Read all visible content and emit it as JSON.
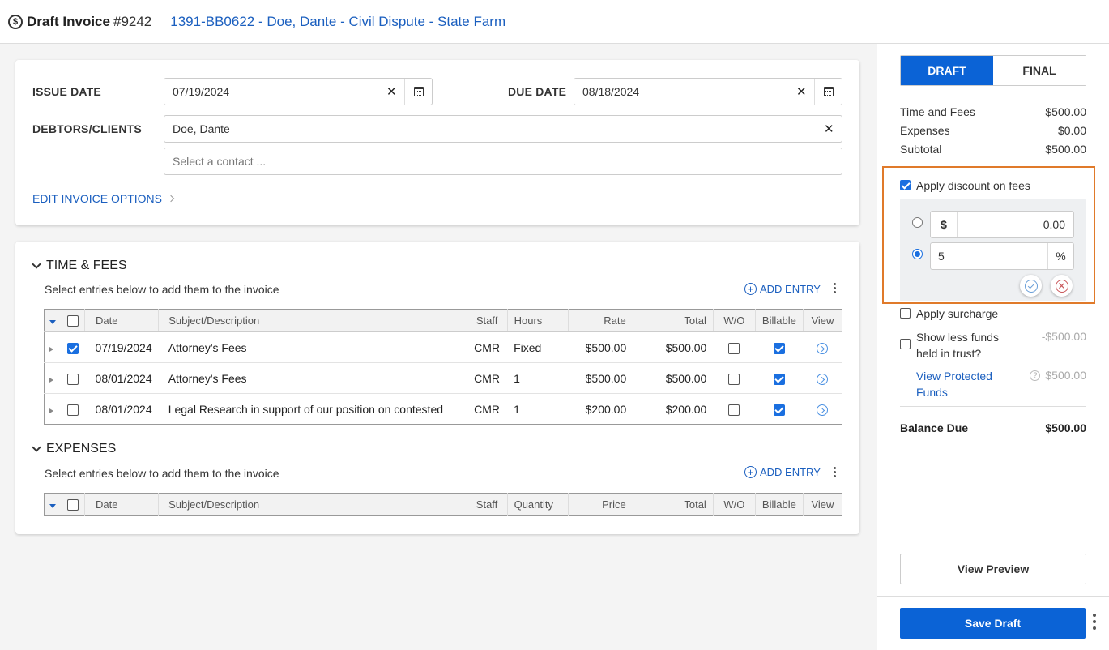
{
  "header": {
    "title": "Draft Invoice",
    "invoice_number": "#9242",
    "matter": "1391-BB0622 - Doe, Dante - Civil Dispute - State Farm"
  },
  "invoice_form": {
    "issue_date_label": "ISSUE DATE",
    "issue_date": "07/19/2024",
    "due_date_label": "DUE DATE",
    "due_date": "08/18/2024",
    "debtors_label": "DEBTORS/CLIENTS",
    "debtor": "Doe, Dante",
    "contact_placeholder": "Select a contact ...",
    "edit_options": "EDIT INVOICE OPTIONS"
  },
  "time_fees": {
    "title": "TIME & FEES",
    "subtitle": "Select entries below to add them to the invoice",
    "add_entry": "ADD ENTRY",
    "columns": [
      "Date",
      "Subject/Description",
      "Staff",
      "Hours",
      "Rate",
      "Total",
      "W/O",
      "Billable",
      "View"
    ],
    "rows": [
      {
        "date": "07/19/2024",
        "subject": "Attorney's Fees",
        "staff": "CMR",
        "hours": "Fixed",
        "rate": "$500.00",
        "total": "$500.00",
        "selected": true,
        "wo": false,
        "billable": true
      },
      {
        "date": "08/01/2024",
        "subject": "Attorney's Fees",
        "staff": "CMR",
        "hours": "1",
        "rate": "$500.00",
        "total": "$500.00",
        "selected": false,
        "wo": false,
        "billable": true
      },
      {
        "date": "08/01/2024",
        "subject": "Legal Research in support of our position on contested",
        "staff": "CMR",
        "hours": "1",
        "rate": "$200.00",
        "total": "$200.00",
        "selected": false,
        "wo": false,
        "billable": true
      }
    ]
  },
  "expenses": {
    "title": "EXPENSES",
    "subtitle": "Select entries below to add them to the invoice",
    "add_entry": "ADD ENTRY",
    "columns": [
      "Date",
      "Subject/Description",
      "Staff",
      "Quantity",
      "Price",
      "Total",
      "W/O",
      "Billable",
      "View"
    ]
  },
  "summary": {
    "tab_draft": "DRAFT",
    "tab_final": "FINAL",
    "time_fees_label": "Time and Fees",
    "time_fees_value": "$500.00",
    "expenses_label": "Expenses",
    "expenses_value": "$0.00",
    "subtotal_label": "Subtotal",
    "subtotal_value": "$500.00",
    "apply_discount_label": "Apply discount on fees",
    "discount_dollar_symbol": "$",
    "discount_dollar_value": "0.00",
    "discount_percent_value": "5",
    "discount_percent_symbol": "%",
    "apply_surcharge_label": "Apply surcharge",
    "trust_label_1": "Show less funds",
    "trust_label_2": "held in trust?",
    "trust_value": "-$500.00",
    "protected_link_1": "View Protected",
    "protected_link_2": "Funds",
    "protected_value": "$500.00",
    "balance_label": "Balance Due",
    "balance_value": "$500.00",
    "view_preview": "View Preview",
    "save_draft": "Save Draft"
  },
  "colors": {
    "primary": "#0b63d6",
    "link": "#1b5fbf",
    "highlight": "#e07a2a"
  }
}
